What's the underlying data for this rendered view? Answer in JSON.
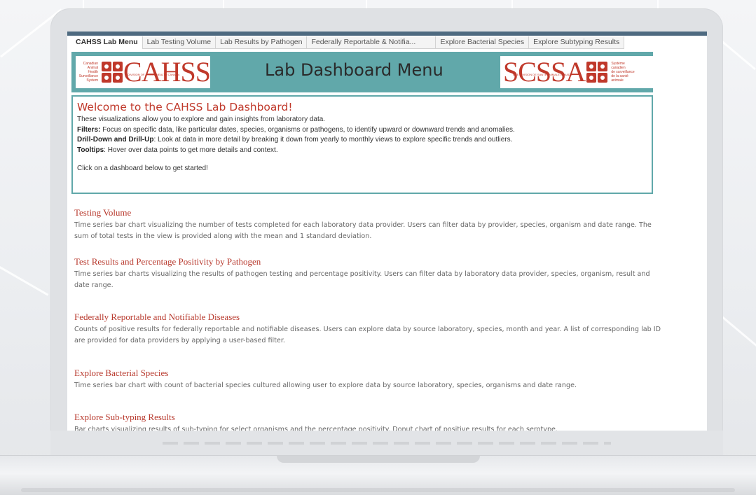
{
  "tabs": [
    {
      "label": "CAHSS Lab Menu",
      "active": true
    },
    {
      "label": "Lab Testing Volume",
      "active": false
    },
    {
      "label": "Lab Results by Pathogen",
      "active": false
    },
    {
      "label": "Federally Reportable & Notifia...",
      "active": false
    },
    {
      "label": "Explore Bacterial Species",
      "active": false
    },
    {
      "label": "Explore Subtyping Results",
      "active": false
    }
  ],
  "banner": {
    "title": "Lab Dashboard Menu",
    "logo_left": {
      "word": "CAHSS",
      "small_lines": [
        "Canadian",
        "Animal",
        "Health",
        "Surveillance",
        "System"
      ],
      "subtitle": "DIVISION OF ANIMAL HEALTH CANADA"
    },
    "logo_right": {
      "word": "SCSSA",
      "small_lines": [
        "Système",
        "canadien",
        "de surveillance",
        "de la santé",
        "animale"
      ],
      "subtitle": "UNE DIVISION DE SANTÉ ANIMALE CANADA"
    }
  },
  "welcome": {
    "heading": "Welcome to the CAHSS Lab Dashboard!",
    "intro": "These visualizations allow you to explore and gain insights from laboratory data.",
    "filters_label": "Filters:",
    "filters_text": " Focus on specific data, like particular dates, species, organisms or pathogens, to identify upward or downward trends and anomalies.",
    "drill_label": "Drill-Down and Drill-Up",
    "drill_text": ": Look at data in more detail by breaking it down from yearly to monthly views to explore specific trends and outliers.",
    "tooltips_label": "Tooltips",
    "tooltips_text": ": Hover over data points to get more details and context.",
    "cta": "Click on a dashboard below to get started!"
  },
  "sections": [
    {
      "title": "Testing Volume",
      "desc": "Time series bar chart visualizing the number of tests completed for each laboratory data provider. Users can filter data by provider, species, organism and date range. The sum of total tests in the view is provided along with the mean and 1 standard deviation."
    },
    {
      "title": "Test Results and Percentage Positivity by Pathogen",
      "desc": "Time series bar charts visualizing the results of pathogen testing and percentage positivity. Users can filter data by laboratory data provider, species, organism, result and date range."
    },
    {
      "title": "Federally Reportable and Notifiable Diseases",
      "desc": "Counts of positive results for federally reportable and notifiable diseases.  Users can explore data by source laboratory, species, month and year.  A list of corresponding lab ID are provided for data providers by applying a user-based filter."
    },
    {
      "title": "Explore Bacterial Species",
      "desc": "Time series bar chart with count of bacterial species cultured allowing user to explore data by source laboratory, species, organisms and date range."
    },
    {
      "title": "Explore Sub-typing Results",
      "desc": "Bar charts visualizing results of sub-typing for select organisms and the percentage positivity. Donut chart of positive results for each serotype."
    }
  ],
  "colors": {
    "banner_teal": "#61a8aa",
    "accent_red": "#c0392b",
    "section_title": "#b83a2e",
    "screen_topbar": "#4e6a80"
  }
}
